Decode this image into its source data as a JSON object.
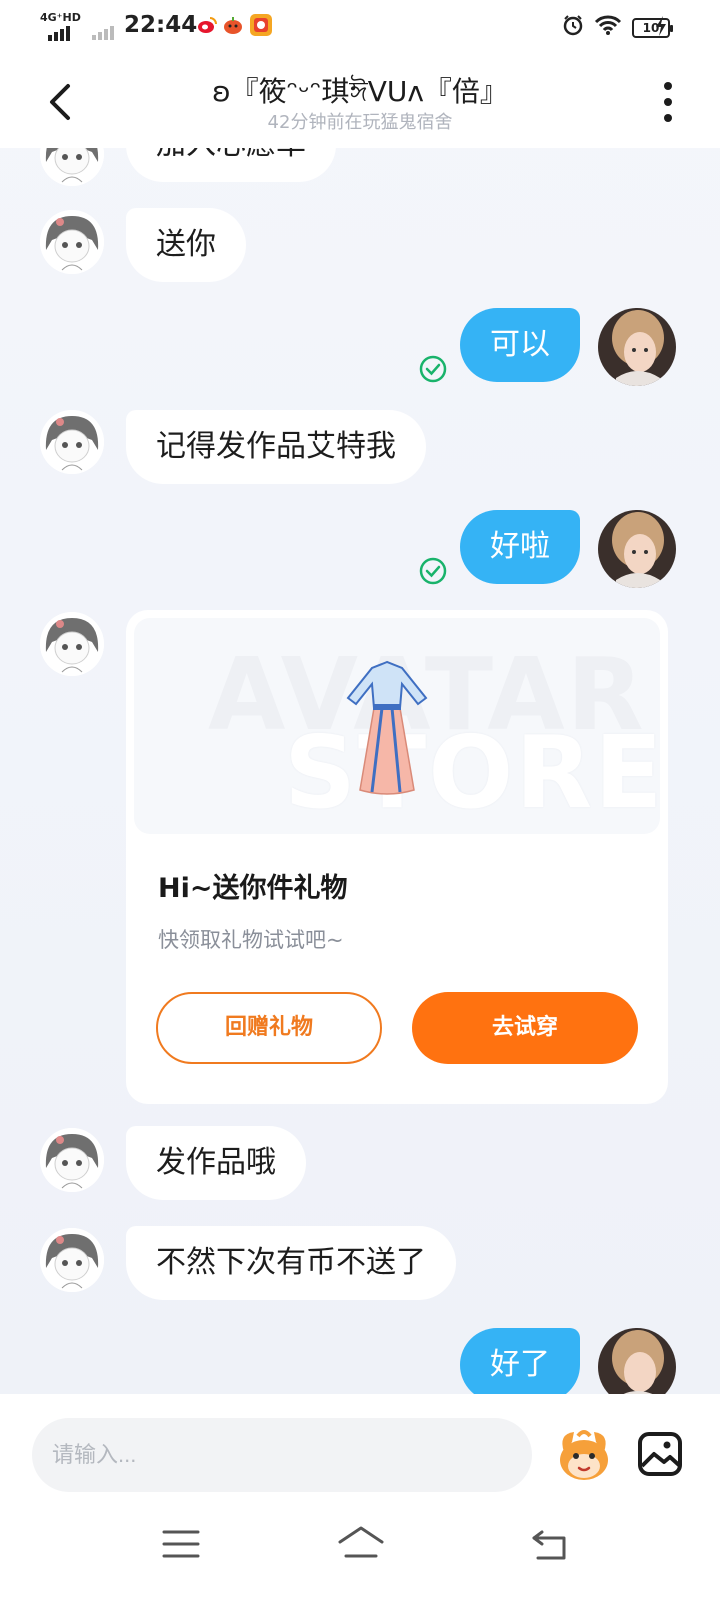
{
  "status_bar": {
    "network": "4G⁺HD",
    "time": "22:44",
    "battery": "10"
  },
  "header": {
    "title": "ʚ『筱ᵔᵕᵔ琪ঈVUᴧ『倍』",
    "subtitle": "42分钟前在玩猛鬼宿舍"
  },
  "messages": [
    {
      "side": "left",
      "text": "加入心愿单"
    },
    {
      "side": "left",
      "text": "送你"
    },
    {
      "side": "right",
      "text": "可以",
      "read": true
    },
    {
      "side": "left",
      "text": "记得发作品艾特我"
    },
    {
      "side": "right",
      "text": "好啦",
      "read": true
    },
    {
      "side": "left",
      "text": "发作品哦"
    },
    {
      "side": "left",
      "text": "不然下次有币不送了"
    },
    {
      "side": "right",
      "text": "好了"
    }
  ],
  "gift_card": {
    "banner_text_1": "AVATAR",
    "banner_text_2": "STORE",
    "title": "Hi~送你件礼物",
    "subtitle": "快领取礼物试试吧~",
    "return_button": "回赠礼物",
    "try_button": "去试穿"
  },
  "input_bar": {
    "placeholder": "请输入..."
  },
  "icons": {
    "back": "chevron-left-icon",
    "more": "more-vertical-icon",
    "read": "check-circle-icon",
    "emoji": "mascot-emoji-icon",
    "image": "image-icon"
  },
  "colors": {
    "my_bubble": "#35b3f5",
    "their_bubble": "#ffffff",
    "accent_orange": "#ff7210",
    "read_check": "#19b36b"
  }
}
